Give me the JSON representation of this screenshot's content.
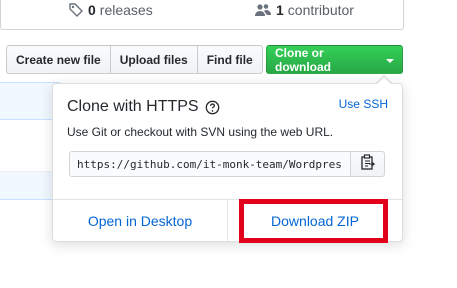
{
  "stats": {
    "releases_count": "0",
    "releases_label": "releases",
    "contributors_count": "1",
    "contributors_label": "contributor"
  },
  "toolbar": {
    "create_new_file": "Create new file",
    "upload_files": "Upload files",
    "find_file": "Find file",
    "clone_or_download": "Clone or download"
  },
  "clone": {
    "title": "Clone with HTTPS",
    "use_ssh": "Use SSH",
    "description": "Use Git or checkout with SVN using the web URL.",
    "url": "https://github.com/it-monk-team/Wordpress",
    "open_in_desktop": "Open in Desktop",
    "download_zip": "Download ZIP"
  },
  "colors": {
    "accent": "#0366d6",
    "primary_button": "#28a745",
    "highlight": "#e2001a"
  }
}
